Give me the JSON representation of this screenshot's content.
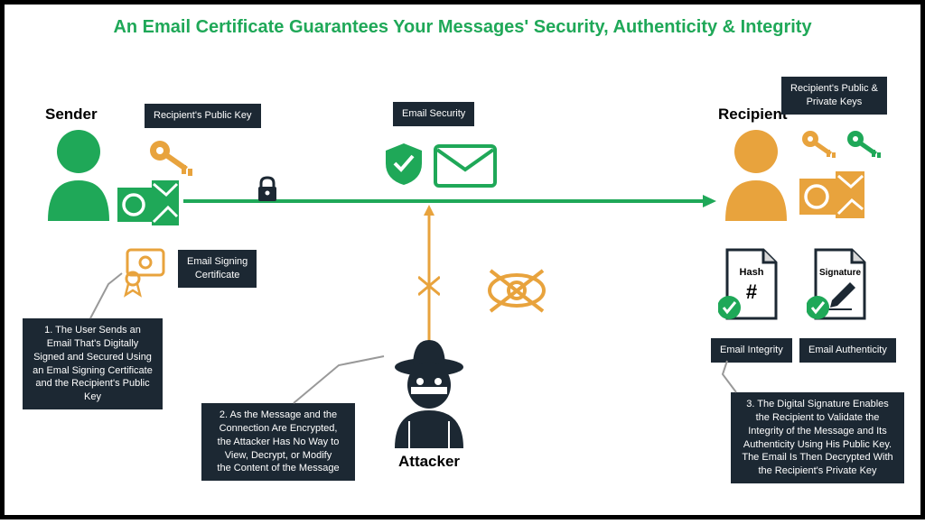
{
  "title": "An Email Certificate Guarantees Your Messages' Security, Authenticity & Integrity",
  "roles": {
    "sender": "Sender",
    "attacker": "Attacker",
    "recipient": "Recipient"
  },
  "labels": {
    "recipientPublicKey": "Recipient's Public Key",
    "emailSecurity": "Email Security",
    "recipientKeys": "Recipient's Public &\nPrivate Keys",
    "signingCert": "Email Signing\nCertificate",
    "integrity": "Email Integrity",
    "authenticity": "Email Authenticity",
    "hash": "Hash",
    "signature": "Signature"
  },
  "steps": {
    "s1": "1. The User Sends an\nEmail That's Digitally\nSigned and Secured Using\nan Emal Signing Certificate\nand the Recipient's Public\nKey",
    "s2": "2. As the Message and the\nConnection Are Encrypted,\nthe Attacker Has No Way to\nView, Decrypt, or Modify\nthe Content of the Message",
    "s3": "3. The Digital Signature Enables\nthe Recipient to Validate the\nIntegrity of the Message and Its\nAuthenticity Using His Public Key.\nThe Email Is Then Decrypted With\nthe Recipient's Private Key"
  }
}
